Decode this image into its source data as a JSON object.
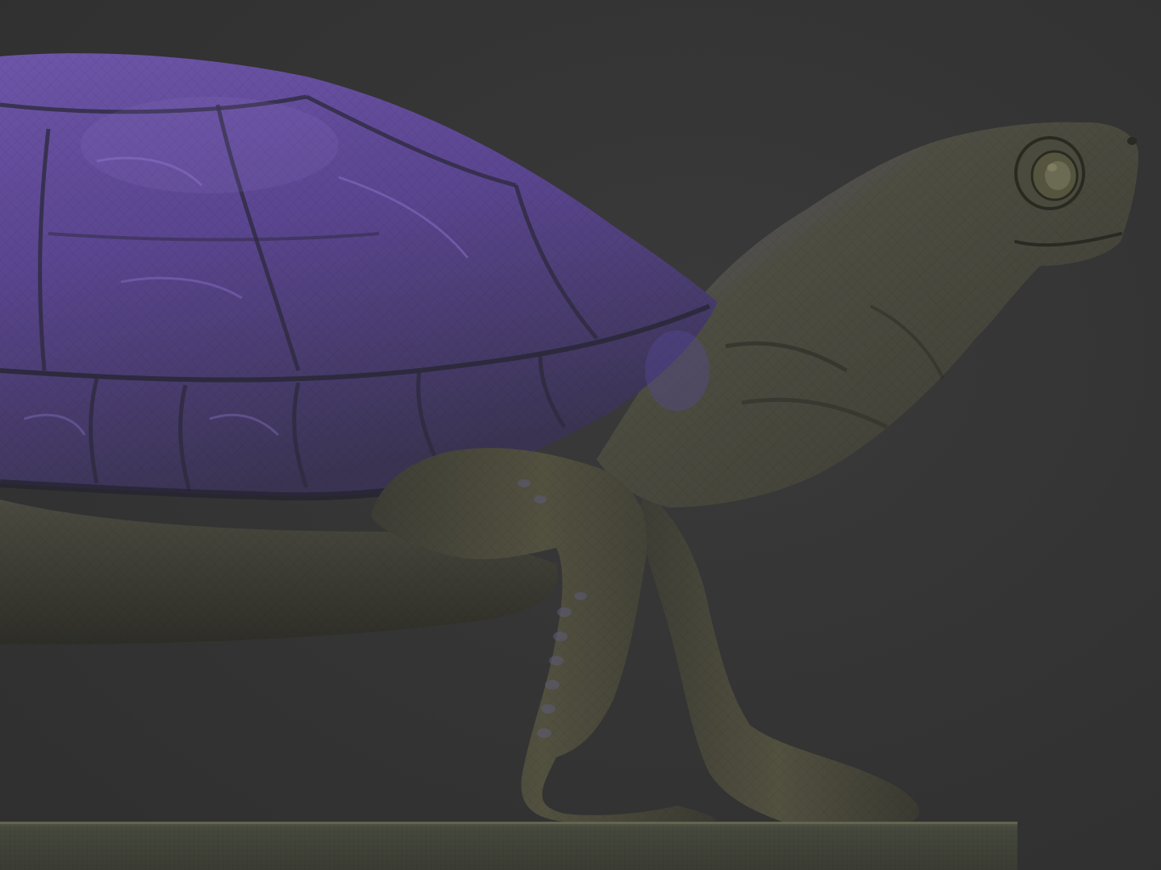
{
  "scene": {
    "subject": "turtle-sculpt",
    "colors": {
      "background": "#343434",
      "shell_light": "#7a5fb5",
      "shell_mid": "#5a4488",
      "shell_dark": "#3a3450",
      "skin_light": "#5a5a4a",
      "skin_mid": "#45463a",
      "skin_dark": "#2e2f28",
      "base_top": "#4a4d40",
      "base_front": "#3d3f35"
    }
  }
}
